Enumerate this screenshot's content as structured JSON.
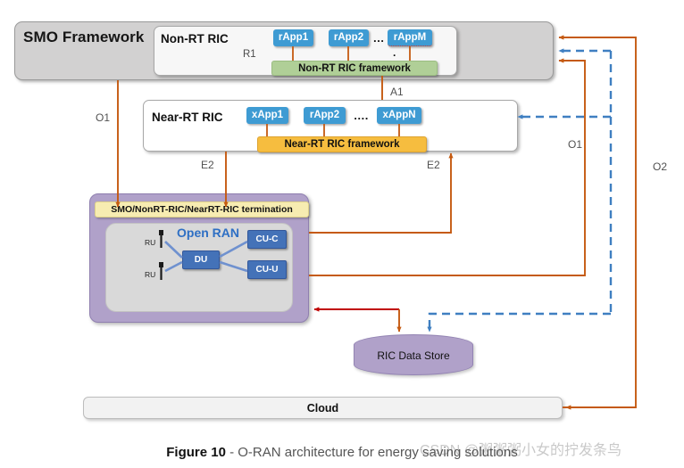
{
  "diagram": {
    "smo": {
      "title": "SMO Framework"
    },
    "non_rt_ric": {
      "title": "Non-RT RIC",
      "r1_label": "R1",
      "apps": [
        "rApp1",
        "rApp2",
        "rAppM"
      ],
      "ellipsis": "…",
      "dot": ".",
      "framework": "Non-RT RIC framework"
    },
    "near_rt_ric": {
      "title": "Near-RT RIC",
      "apps": [
        "xApp1",
        "rApp2",
        "xAppN"
      ],
      "ellipsis": "….",
      "framework": "Near-RT RIC framework"
    },
    "open_ran": {
      "termination": "SMO/NonRT-RIC/NearRT-RIC termination",
      "title": "Open RAN",
      "nodes": [
        "DU",
        "CU-C",
        "CU-U"
      ],
      "ru_labels": [
        "RU",
        "RU"
      ]
    },
    "data_store": {
      "label": "RIC Data Store"
    },
    "cloud": {
      "label": "Cloud"
    },
    "interfaces": {
      "a1": "A1",
      "o1_left": "O1",
      "e2_left": "E2",
      "e2_right": "E2",
      "o1_right": "O1",
      "o2": "O2"
    },
    "colors": {
      "smo_grey": "#d2d1d1",
      "app_blue": "#3e9bd3",
      "nonrt_framework_green": "#b0cf97",
      "nearrt_framework_orange": "#f6bd3f",
      "ran_purple": "#b0a1c9",
      "termination_yellow": "#f7ecb1",
      "ran_node_blue": "#4472b8",
      "open_ran_text_blue": "#2e6fc4",
      "orange_connector": "#c55a11",
      "blue_dashed_connector": "#3f7fc1",
      "red_connector": "#c00000",
      "cloud_grey": "#f2f2f2"
    }
  },
  "caption": {
    "figure": "Figure 10",
    "text": " - O-RAN architecture for energy saving solutions"
  },
  "watermark": {
    "text": "CSDN @粥粥粥小女的拧发条鸟"
  }
}
